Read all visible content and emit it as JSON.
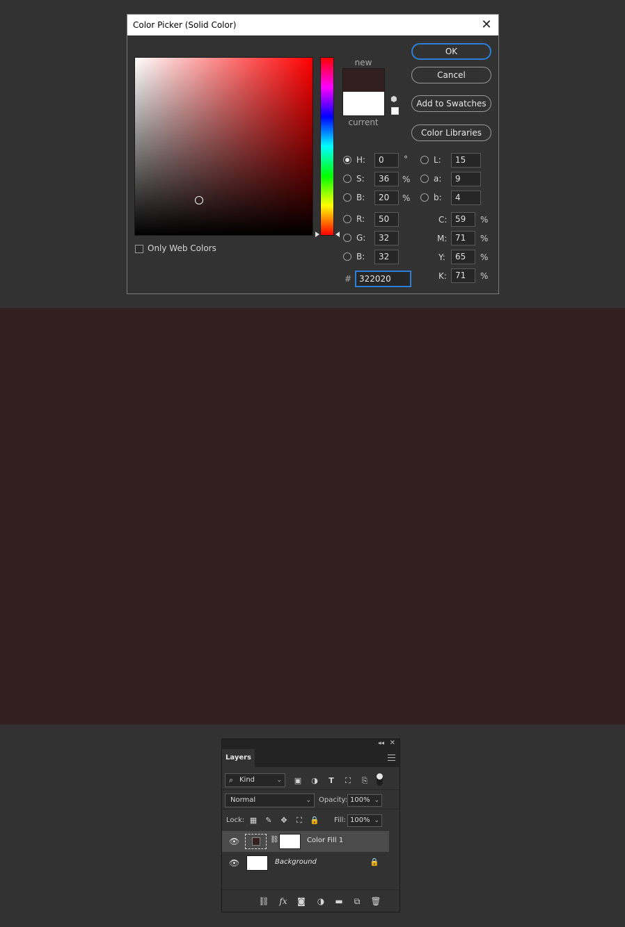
{
  "dialog": {
    "title": "Color Picker (Solid Color)",
    "close_glyph": "✕",
    "new_label": "new",
    "current_label": "current",
    "new_color": "#322020",
    "current_color": "#ffffff",
    "buttons": {
      "ok": "OK",
      "cancel": "Cancel",
      "add_swatches": "Add to Swatches",
      "color_libraries": "Color Libraries"
    },
    "only_web_colors": "Only Web Colors",
    "fields": {
      "H": {
        "label": "H:",
        "value": "0",
        "unit": "°"
      },
      "S": {
        "label": "S:",
        "value": "36",
        "unit": "%"
      },
      "Bv": {
        "label": "B:",
        "value": "20",
        "unit": "%"
      },
      "R": {
        "label": "R:",
        "value": "50"
      },
      "G": {
        "label": "G:",
        "value": "32"
      },
      "B": {
        "label": "B:",
        "value": "32"
      },
      "L": {
        "label": "L:",
        "value": "15"
      },
      "a": {
        "label": "a:",
        "value": "9"
      },
      "b": {
        "label": "b:",
        "value": "4"
      },
      "C": {
        "label": "C:",
        "value": "59",
        "unit": "%"
      },
      "M": {
        "label": "M:",
        "value": "71",
        "unit": "%"
      },
      "Y": {
        "label": "Y:",
        "value": "65",
        "unit": "%"
      },
      "K": {
        "label": "K:",
        "value": "71",
        "unit": "%"
      }
    },
    "hex_label": "#",
    "hex": "322020",
    "accent": "#2d7fd6"
  },
  "canvas": {
    "fill": "#322020"
  },
  "layers_panel": {
    "tab": "Layers",
    "filter_kind": "Kind",
    "blend_mode": "Normal",
    "opacity_label": "Opacity:",
    "opacity": "100%",
    "lock_label": "Lock:",
    "fill_label": "Fill:",
    "fill": "100%",
    "layers": [
      {
        "name": "Color Fill 1",
        "thumb_color": "#322020",
        "mask_color": "#ffffff",
        "selected": true
      },
      {
        "name": "Background",
        "thumb_color": "#ffffff",
        "locked": true
      }
    ]
  }
}
